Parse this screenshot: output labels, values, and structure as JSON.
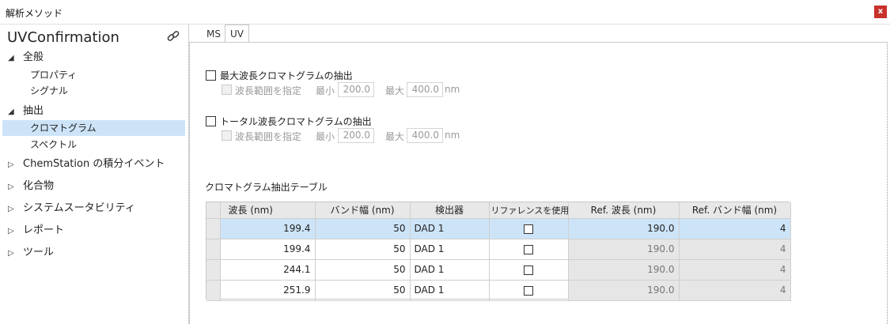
{
  "window": {
    "title": "解析メソッド",
    "close_label": "x"
  },
  "sidebar": {
    "method_name": "UVConfirmation",
    "items": [
      {
        "label": "全般",
        "expanded": true
      },
      {
        "label": "プロパティ"
      },
      {
        "label": "シグナル"
      },
      {
        "label": "抽出",
        "expanded": true
      },
      {
        "label": "クロマトグラム",
        "selected": true
      },
      {
        "label": "スペクトル"
      },
      {
        "label": "ChemStation の積分イベント",
        "expanded": false
      },
      {
        "label": "化合物",
        "expanded": false
      },
      {
        "label": "システムスータビリティ",
        "expanded": false
      },
      {
        "label": "レポート",
        "expanded": false
      },
      {
        "label": "ツール",
        "expanded": false
      }
    ]
  },
  "tabs": {
    "ms": "MS",
    "uv": "UV",
    "active": "UV"
  },
  "max_extract": {
    "checkbox_label": "最大波長クロマトグラムの抽出",
    "range_label": "波長範囲を指定",
    "min_label": "最小",
    "min_value": "200.0",
    "max_label": "最大",
    "max_value": "400.0",
    "unit": "nm"
  },
  "total_extract": {
    "checkbox_label": "トータル波長クロマトグラムの抽出",
    "range_label": "波長範囲を指定",
    "min_label": "最小",
    "min_value": "200.0",
    "max_label": "最大",
    "max_value": "400.0",
    "unit": "nm"
  },
  "table": {
    "title": "クロマトグラム抽出テーブル",
    "headers": [
      "波長 (nm)",
      "バンド幅 (nm)",
      "検出器",
      "リファレンスを使用",
      "Ref. 波長 (nm)",
      "Ref. バンド幅 (nm)"
    ],
    "rows": [
      {
        "wavelength": "199.4",
        "bandwidth": "50",
        "detector": "DAD 1",
        "use_ref": false,
        "ref_wavelength": "190.0",
        "ref_bandwidth": "4",
        "selected": true
      },
      {
        "wavelength": "199.4",
        "bandwidth": "50",
        "detector": "DAD 1",
        "use_ref": false,
        "ref_wavelength": "190.0",
        "ref_bandwidth": "4"
      },
      {
        "wavelength": "244.1",
        "bandwidth": "50",
        "detector": "DAD 1",
        "use_ref": false,
        "ref_wavelength": "190.0",
        "ref_bandwidth": "4"
      },
      {
        "wavelength": "251.9",
        "bandwidth": "50",
        "detector": "DAD 1",
        "use_ref": false,
        "ref_wavelength": "190.0",
        "ref_bandwidth": "4"
      }
    ]
  },
  "colors": {
    "selection": "#cde4f8",
    "close_button": "#c8302a"
  }
}
